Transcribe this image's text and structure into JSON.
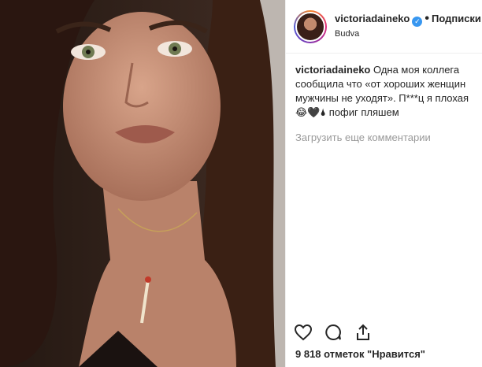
{
  "header": {
    "username": "victoriadaineko",
    "separator": "•",
    "follow_label": "Подписки",
    "location": "Budva"
  },
  "caption": {
    "username": "victoriadaineko",
    "text": "Одна моя коллега сообщила что «от хороших женщин мужчины не уходят». П***ц я плохая😂🖤🌢 пофиг пляшем"
  },
  "load_more_label": "Загрузить еще комментарии",
  "likes_text": "9 818 отметок \"Нравится\"",
  "colors": {
    "verified": "#3897f0",
    "muted": "#999999"
  },
  "icons": [
    "heart-icon",
    "comment-icon",
    "share-icon",
    "verified-badge-icon"
  ]
}
